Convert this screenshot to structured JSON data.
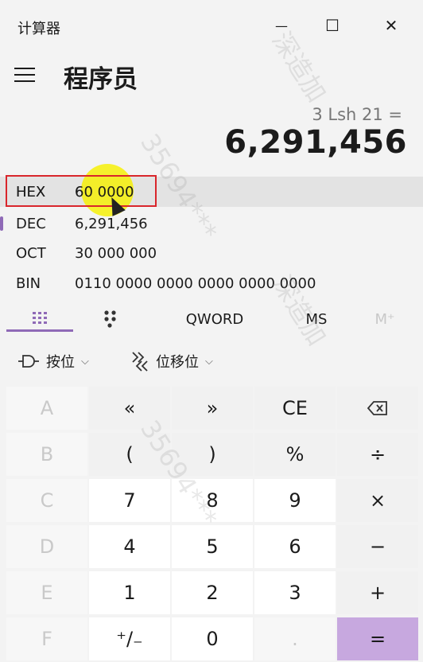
{
  "titlebar": {
    "title": "计算器",
    "minimize": "—",
    "maximize": "☐",
    "close": "✕"
  },
  "header": {
    "mode_title": "程序员"
  },
  "display": {
    "expression": "3 Lsh 21 =",
    "result": "6,291,456"
  },
  "radix": [
    {
      "label": "HEX",
      "value": "60 0000"
    },
    {
      "label": "DEC",
      "value": "6,291,456"
    },
    {
      "label": "OCT",
      "value": "30 000 000"
    },
    {
      "label": "BIN",
      "value": "0110 0000 0000 0000 0000 0000"
    }
  ],
  "tabs": {
    "keypad_icon": "keypad-icon",
    "bitflip_icon": "bit-toggle-icon",
    "word": "QWORD",
    "ms": "MS",
    "mplus": "M⁺"
  },
  "ops": {
    "bitwise": "按位",
    "bitshift": "位移位",
    "chevron": "⌵"
  },
  "keys": [
    [
      "A",
      "«",
      "»",
      "CE",
      "⌫"
    ],
    [
      "B",
      "(",
      ")",
      "%",
      "÷"
    ],
    [
      "C",
      "7",
      "8",
      "9",
      "×"
    ],
    [
      "D",
      "4",
      "5",
      "6",
      "−"
    ],
    [
      "E",
      "1",
      "2",
      "3",
      "+"
    ],
    [
      "F",
      "⁺∕₋",
      "0",
      ".",
      "="
    ]
  ],
  "watermark": [
    "35694***",
    "深造加",
    "35694***",
    "深造加"
  ],
  "colors": {
    "accent": "#8f6ab7",
    "equals_bg": "#c7a8df",
    "highlight_border": "#d9262c",
    "cursor_glow": "#f6f000"
  }
}
